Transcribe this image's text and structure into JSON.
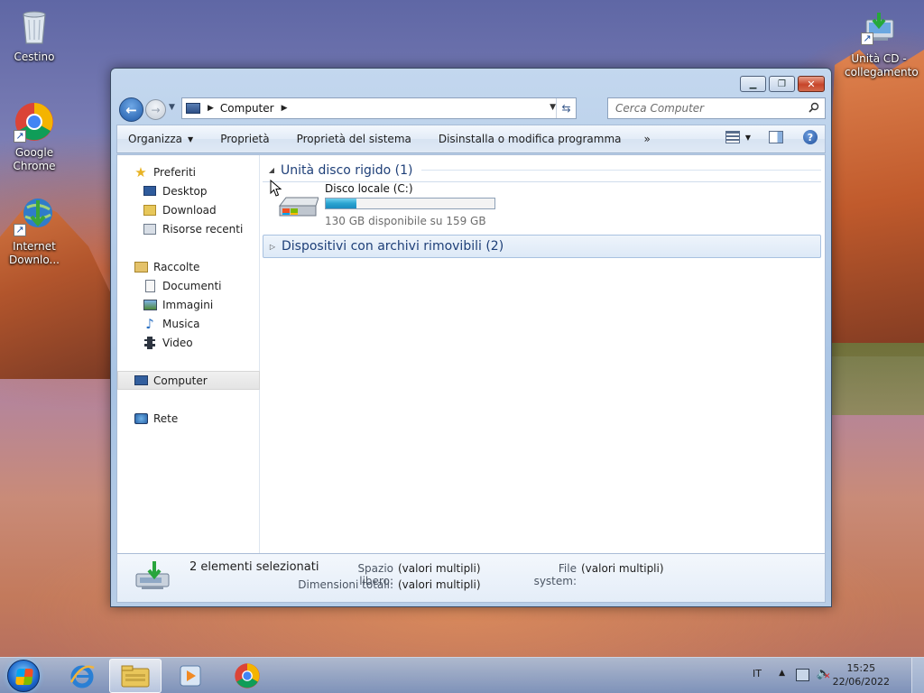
{
  "desktop": {
    "icons": [
      {
        "label": "Cestino",
        "icon": "recycle-bin-icon"
      },
      {
        "label": "Google Chrome",
        "icon": "chrome-icon"
      },
      {
        "label": "Internet Downlo...",
        "icon": "internet-download-manager-icon"
      },
      {
        "label": "Unità CD - collegamento",
        "icon": "cd-drive-shortcut-icon"
      }
    ]
  },
  "window": {
    "address": {
      "crumb": "Computer"
    },
    "search": {
      "placeholder": "Cerca Computer"
    },
    "toolbar": {
      "organize": "Organizza",
      "properties": "Proprietà",
      "system_properties": "Proprietà del sistema",
      "uninstall": "Disinstalla o modifica programma",
      "more": "»"
    },
    "nav_pane": {
      "favorites_header": "Preferiti",
      "favorites": [
        "Desktop",
        "Download",
        "Risorse recenti"
      ],
      "libraries_header": "Raccolte",
      "libraries": [
        "Documenti",
        "Immagini",
        "Musica",
        "Video"
      ],
      "computer": "Computer",
      "network": "Rete"
    },
    "groups": {
      "hard_drives": "Unità disco rigido (1)",
      "removable": "Dispositivi con archivi rimovibili (2)"
    },
    "drive": {
      "name": "Disco locale (C:)",
      "free_text": "130 GB disponibile su 159 GB",
      "used_fraction": 0.18
    },
    "details": {
      "count": "2 elementi selezionati",
      "free_space_label": "Spazio libero:",
      "free_space_value": "(valori multipli)",
      "total_size_label": "Dimensioni totali:",
      "total_size_value": "(valori multipli)",
      "fs_label": "File system:",
      "fs_value": "(valori multipli)"
    }
  },
  "taskbar": {
    "language": "IT",
    "time": "15:25",
    "date": "22/06/2022",
    "apps": [
      "internet-explorer-icon",
      "windows-explorer-icon",
      "media-player-icon",
      "chrome-icon"
    ]
  },
  "colors": {
    "accent": "#1e3f78",
    "progress": "#2aa3d0"
  }
}
